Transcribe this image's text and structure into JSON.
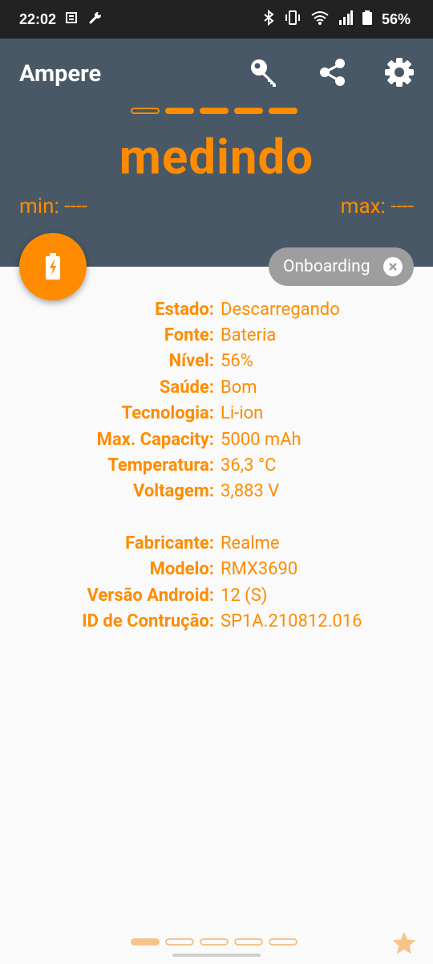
{
  "status_bar": {
    "time": "22:02",
    "battery_percent": "56%",
    "icons_left": [
      "notification-icon",
      "wrench-icon"
    ],
    "icons_right": [
      "bluetooth-icon",
      "vibrate-icon",
      "wifi-icon",
      "signal-icon",
      "battery-icon"
    ]
  },
  "app": {
    "title": "Ampere",
    "actions": [
      "key-icon",
      "share-icon",
      "settings-icon"
    ]
  },
  "meter": {
    "status_word": "medindo",
    "min_text": "min: ----",
    "max_text": "max: ----"
  },
  "onboarding": {
    "label": "Onboarding"
  },
  "details": [
    {
      "label": "Estado:",
      "value": "Descarregando"
    },
    {
      "label": "Fonte:",
      "value": "Bateria"
    },
    {
      "label": "Nível:",
      "value": "56%"
    },
    {
      "label": "Saúde:",
      "value": "Bom"
    },
    {
      "label": "Tecnologia:",
      "value": "Li-ion"
    },
    {
      "label": "Max. Capacity:",
      "value": "5000 mAh"
    },
    {
      "label": "Temperatura:",
      "value": "36,3 °C"
    },
    {
      "label": "Voltagem:",
      "value": "3,883 V"
    }
  ],
  "device": [
    {
      "label": "Fabricante:",
      "value": "Realme"
    },
    {
      "label": "Modelo:",
      "value": "RMX3690"
    },
    {
      "label": "Versão Android:",
      "value": "12 (S)"
    },
    {
      "label": "ID de Contrução:",
      "value": "SP1A.210812.016"
    }
  ],
  "colors": {
    "accent": "#ff8c00",
    "header_bg": "#485866",
    "status_bar_bg": "#222222",
    "chip_bg": "#9e9e9e"
  }
}
